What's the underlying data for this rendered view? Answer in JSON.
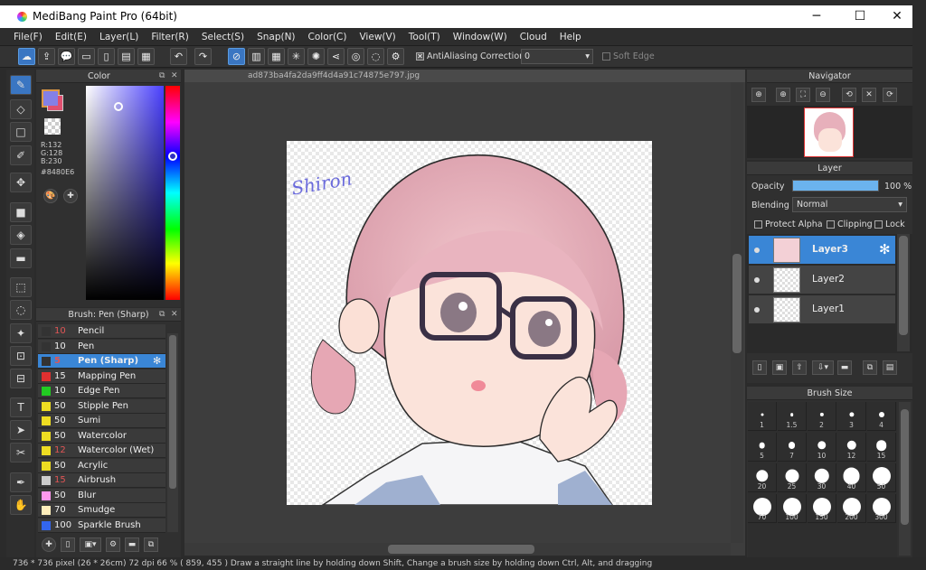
{
  "window": {
    "title": "MediBang Paint Pro (64bit)",
    "minimize": "─",
    "maximize": "☐",
    "close": "✕"
  },
  "menu": [
    "File(F)",
    "Edit(E)",
    "Layer(L)",
    "Filter(R)",
    "Select(S)",
    "Snap(N)",
    "Color(C)",
    "View(V)",
    "Tool(T)",
    "Window(W)",
    "Cloud",
    "Help"
  ],
  "toolbar": {
    "antialiasing_label": "AntiAliasing",
    "correction_label": "Correction",
    "correction_value": "0",
    "softedge_label": "Soft Edge"
  },
  "color": {
    "title": "Color",
    "r": "R:132",
    "g": "G:128",
    "b": "B:230",
    "hex": "#8480E6",
    "fg": "#8480e6",
    "bg": "#e05070"
  },
  "brush": {
    "title": "Brush: Pen (Sharp)",
    "items": [
      {
        "size": "10",
        "name": "Pencil",
        "color": "#333333",
        "sizecolor": "#e05555"
      },
      {
        "size": "10",
        "name": "Pen",
        "color": "#333333",
        "sizecolor": "#eeeeee"
      },
      {
        "size": "5",
        "name": "Pen (Sharp)",
        "color": "#333333",
        "sizecolor": "#e05555"
      },
      {
        "size": "15",
        "name": "Mapping Pen",
        "color": "#e03030",
        "sizecolor": "#eeeeee"
      },
      {
        "size": "10",
        "name": "Edge Pen",
        "color": "#22cc22",
        "sizecolor": "#eeeeee"
      },
      {
        "size": "50",
        "name": "Stipple Pen",
        "color": "#eedd22",
        "sizecolor": "#eeeeee"
      },
      {
        "size": "50",
        "name": "Sumi",
        "color": "#eedd22",
        "sizecolor": "#eeeeee"
      },
      {
        "size": "50",
        "name": "Watercolor",
        "color": "#eedd22",
        "sizecolor": "#eeeeee"
      },
      {
        "size": "12",
        "name": "Watercolor (Wet)",
        "color": "#eedd22",
        "sizecolor": "#e05555"
      },
      {
        "size": "50",
        "name": "Acrylic",
        "color": "#eedd22",
        "sizecolor": "#eeeeee"
      },
      {
        "size": "15",
        "name": "Airbrush",
        "color": "#cccccc",
        "sizecolor": "#e05555"
      },
      {
        "size": "50",
        "name": "Blur",
        "color": "#ff99ee",
        "sizecolor": "#eeeeee"
      },
      {
        "size": "70",
        "name": "Smudge",
        "color": "#ffeebb",
        "sizecolor": "#eeeeee"
      },
      {
        "size": "100",
        "name": "Sparkle Brush",
        "color": "#3366ee",
        "sizecolor": "#eeeeee"
      }
    ]
  },
  "canvas": {
    "tab": "ad873ba4fa2da9ff4d4a91c74875e797.jpg",
    "signature": "Shiron"
  },
  "navigator": {
    "title": "Navigator"
  },
  "layer": {
    "title": "Layer",
    "opacity_label": "Opacity",
    "opacity_value": "100 %",
    "opacity_fraction": 1.0,
    "blending_label": "Blending",
    "blending_value": "Normal",
    "protect_alpha": "Protect Alpha",
    "clipping": "Clipping",
    "lock": "Lock",
    "items": [
      {
        "name": "Layer3"
      },
      {
        "name": "Layer2"
      },
      {
        "name": "Layer1"
      }
    ]
  },
  "brushsize": {
    "title": "Brush Size",
    "sizes": [
      "1",
      "1.5",
      "2",
      "3",
      "4",
      "5",
      "7",
      "10",
      "12",
      "15",
      "20",
      "25",
      "30",
      "40",
      "50",
      "70",
      "100",
      "150",
      "200",
      "300"
    ]
  },
  "status": "736 * 736 pixel   (26 * 26cm)   72 dpi   66 %   ( 859, 455 )   Draw a straight line by holding down Shift, Change a brush size by holding down Ctrl, Alt, and dragging"
}
